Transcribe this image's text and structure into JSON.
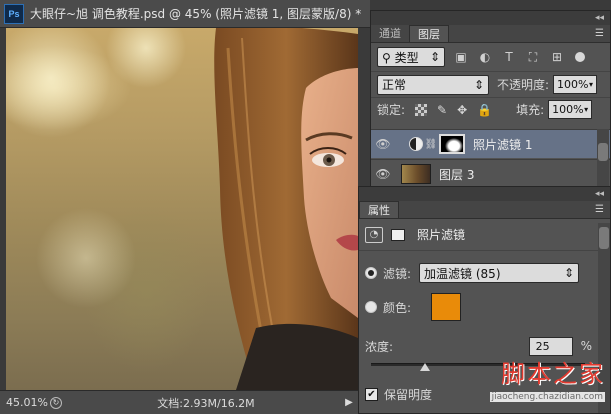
{
  "document": {
    "app_badge": "Ps",
    "title": "大眼仔~旭 调色教程.psd @ 45% (照片滤镜 1, 图层蒙版/8) *"
  },
  "statusbar": {
    "zoom": "45.01%",
    "doc_size": "文档:2.93M/16.2M",
    "arrow": "▶"
  },
  "layers_panel": {
    "collapse_glyph": "◂◂",
    "tabs": [
      {
        "label": "通道",
        "active": false
      },
      {
        "label": "图层",
        "active": true
      }
    ],
    "kind_filter": "类型",
    "filter_icons": [
      "image-filter-icon",
      "adjustment-filter-icon",
      "type-filter-icon",
      "shape-filter-icon",
      "smart-object-filter-icon"
    ],
    "blend_mode": "正常",
    "opacity_label": "不透明度:",
    "opacity_value": "100%",
    "lock_label": "锁定:",
    "fill_label": "填充:",
    "fill_value": "100%",
    "layers": [
      {
        "name": "照片滤镜 1",
        "selected": true
      },
      {
        "name": "图层 3",
        "selected": false
      }
    ]
  },
  "properties_panel": {
    "tab": "属性",
    "collapse_glyph": "◂◂",
    "adjustment_title": "照片滤镜",
    "filter_label": "滤镜:",
    "filter_value": "加温滤镜 (85)",
    "filter_selected": true,
    "color_label": "颜色:",
    "color_selected": false,
    "swatch_color": "#e98b09",
    "density_label": "浓度:",
    "density_value": "25",
    "density_unit": "%",
    "density_fraction": 0.25,
    "preserve_luminosity_label": "保留明度",
    "preserve_luminosity_checked": true
  },
  "watermark": {
    "line1": "脚本之家",
    "line2": "jiaocheng.chazidian.com"
  }
}
